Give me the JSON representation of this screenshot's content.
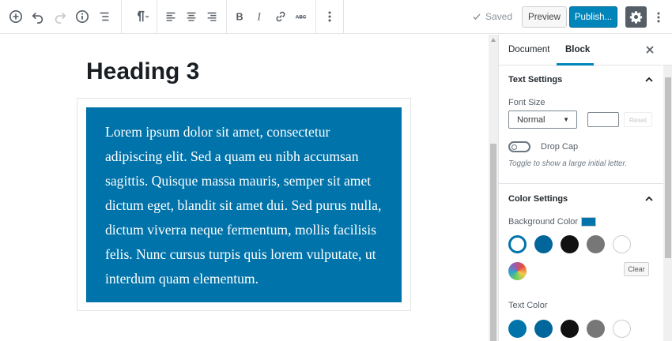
{
  "toolbar": {
    "icons": [
      "add-block-icon",
      "undo-icon",
      "redo-icon",
      "info-icon",
      "outline-icon",
      "paragraph-icon",
      "align-left-icon",
      "align-center-icon",
      "align-right-icon",
      "bold-icon",
      "italic-icon",
      "link-icon",
      "strikethrough-icon",
      "more-options-icon"
    ],
    "saved_label": "Saved",
    "preview_label": "Preview",
    "publish_label": "Publish...",
    "strikethrough_glyph": "ABC",
    "accent_color": "#0085ba"
  },
  "editor": {
    "heading": "Heading 3",
    "paragraph": "Lorem ipsum dolor sit amet, consectetur adipiscing elit. Sed a quam eu nibh accumsan sagittis. Quisque massa mauris, semper sit amet dictum eget, blandit sit amet dui. Sed purus nulla, dictum viverra neque fermentum, mollis facilisis felis. Nunc cursus turpis quis lorem vulputate, ut interdum quam elementum.",
    "paragraph_background": "#0073aa"
  },
  "sidebar": {
    "tabs": [
      {
        "label": "Document"
      },
      {
        "label": "Block"
      }
    ],
    "active_tab": "Block",
    "text_settings": {
      "title": "Text Settings",
      "font_size_label": "Font Size",
      "font_size_value": "Normal",
      "custom_size_value": "",
      "reset_label": "Reset",
      "drop_cap_label": "Drop Cap",
      "drop_cap_enabled": false,
      "help_text": "Toggle to show a large initial letter."
    },
    "color_settings": {
      "title": "Color Settings",
      "background_label": "Background Color",
      "background_selected": "#0073aa",
      "palette": [
        "#0073aa",
        "#00669b",
        "#111111",
        "#777777",
        "#ffffff"
      ],
      "clear_label": "Clear",
      "text_color_label": "Text Color"
    }
  }
}
